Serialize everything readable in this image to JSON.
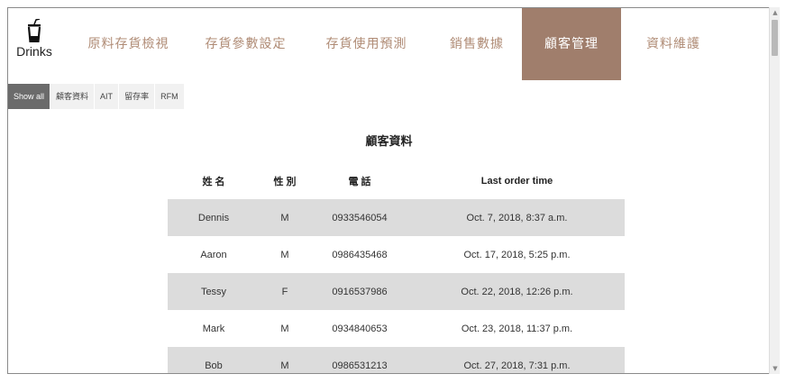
{
  "logo": {
    "text": "Drinks",
    "icon": "cup-icon"
  },
  "nav": [
    {
      "label": "原料存貨檢視",
      "active": false
    },
    {
      "label": "存貨參數設定",
      "active": false
    },
    {
      "label": "存貨使用預測",
      "active": false
    },
    {
      "label": "銷售數據",
      "active": false
    },
    {
      "label": "顧客管理",
      "active": true
    },
    {
      "label": "資料維護",
      "active": false
    }
  ],
  "filters": [
    {
      "label": "Show all",
      "active": true
    },
    {
      "label": "顧客資料",
      "active": false
    },
    {
      "label": "AIT",
      "active": false
    },
    {
      "label": "留存率",
      "active": false
    },
    {
      "label": "RFM",
      "active": false
    }
  ],
  "section_title": "顧客資料",
  "table": {
    "headers": [
      "姓 名",
      "性 別",
      "電 話",
      "Last order time"
    ],
    "rows": [
      [
        "Dennis",
        "M",
        "0933546054",
        "Oct. 7, 2018, 8:37 a.m."
      ],
      [
        "Aaron",
        "M",
        "0986435468",
        "Oct. 17, 2018, 5:25 p.m."
      ],
      [
        "Tessy",
        "F",
        "0916537986",
        "Oct. 22, 2018, 12:26 p.m."
      ],
      [
        "Mark",
        "M",
        "0934840653",
        "Oct. 23, 2018, 11:37 p.m."
      ],
      [
        "Bob",
        "M",
        "0986531213",
        "Oct. 27, 2018, 7:31 p.m."
      ]
    ]
  },
  "colors": {
    "accent": "#a07e6c",
    "nav_text": "#b08c76",
    "row_shade": "#dcdcdc",
    "active_filter": "#6b6b6b"
  }
}
